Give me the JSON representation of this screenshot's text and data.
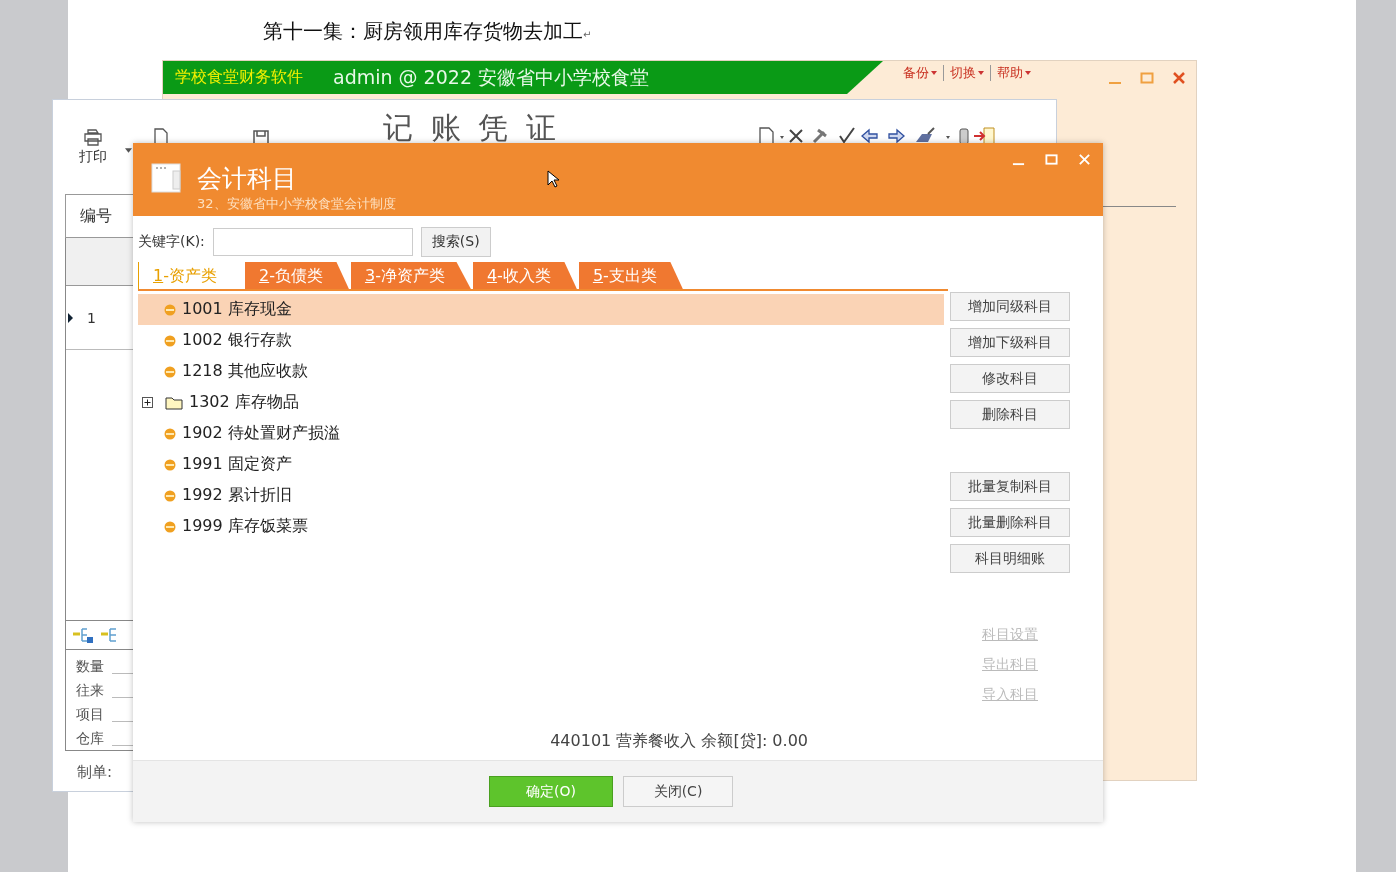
{
  "document": {
    "heading": "第十一集：厨房领用库存货物去加工",
    "para_mark": "↵"
  },
  "app_window": {
    "title": "学校食堂财务软件",
    "user": "admin @ 2022 安徽省中小学校食堂",
    "menu": [
      "备份",
      "切换",
      "帮助"
    ]
  },
  "voucher_window": {
    "title": "记 账 凭 证",
    "print_label": "打印",
    "number_label": "编号",
    "row_number": "1",
    "fields": [
      "数量",
      "往来",
      "项目",
      "仓库"
    ],
    "maker_label": "制单:"
  },
  "dialog": {
    "title": "会计科目",
    "subtitle": "32、安徽省中小学校食堂会计制度",
    "keyword_label": "关键字(K):",
    "search_button": "搜索(S)",
    "tabs": [
      {
        "key": "1",
        "label": "-资产类",
        "selected": true
      },
      {
        "key": "2",
        "label": "-负债类",
        "selected": false
      },
      {
        "key": "3",
        "label": "-净资产类",
        "selected": false
      },
      {
        "key": "4",
        "label": "-收入类",
        "selected": false
      },
      {
        "key": "5",
        "label": "-支出类",
        "selected": false
      }
    ],
    "accounts": [
      {
        "code": "1001",
        "name": "库存现金",
        "kind": "leaf",
        "selected": true
      },
      {
        "code": "1002",
        "name": "银行存款",
        "kind": "leaf",
        "selected": false
      },
      {
        "code": "1218",
        "name": "其他应收款",
        "kind": "leaf",
        "selected": false
      },
      {
        "code": "1302",
        "name": "库存物品",
        "kind": "folder",
        "selected": false,
        "expanded": false
      },
      {
        "code": "1902",
        "name": "待处置财产损溢",
        "kind": "leaf",
        "selected": false
      },
      {
        "code": "1991",
        "name": "固定资产",
        "kind": "leaf",
        "selected": false
      },
      {
        "code": "1992",
        "name": "累计折旧",
        "kind": "leaf",
        "selected": false
      },
      {
        "code": "1999",
        "name": "库存饭菜票",
        "kind": "leaf",
        "selected": false
      }
    ],
    "action_groups": [
      [
        "增加同级科目",
        "增加下级科目",
        "修改科目",
        "删除科目"
      ],
      [
        "批量复制科目",
        "批量删除科目",
        "科目明细账"
      ]
    ],
    "links": [
      {
        "label": "科目设置",
        "disabled": true
      },
      {
        "label": "导出科目",
        "disabled": true
      },
      {
        "label": "导入科目",
        "disabled": true
      }
    ],
    "status": "440101 营养餐收入 余额[贷]: 0.00",
    "buttons": [
      {
        "label": "确定(O)",
        "kind": "primary"
      },
      {
        "label": "关闭(C)",
        "kind": "default"
      }
    ]
  }
}
